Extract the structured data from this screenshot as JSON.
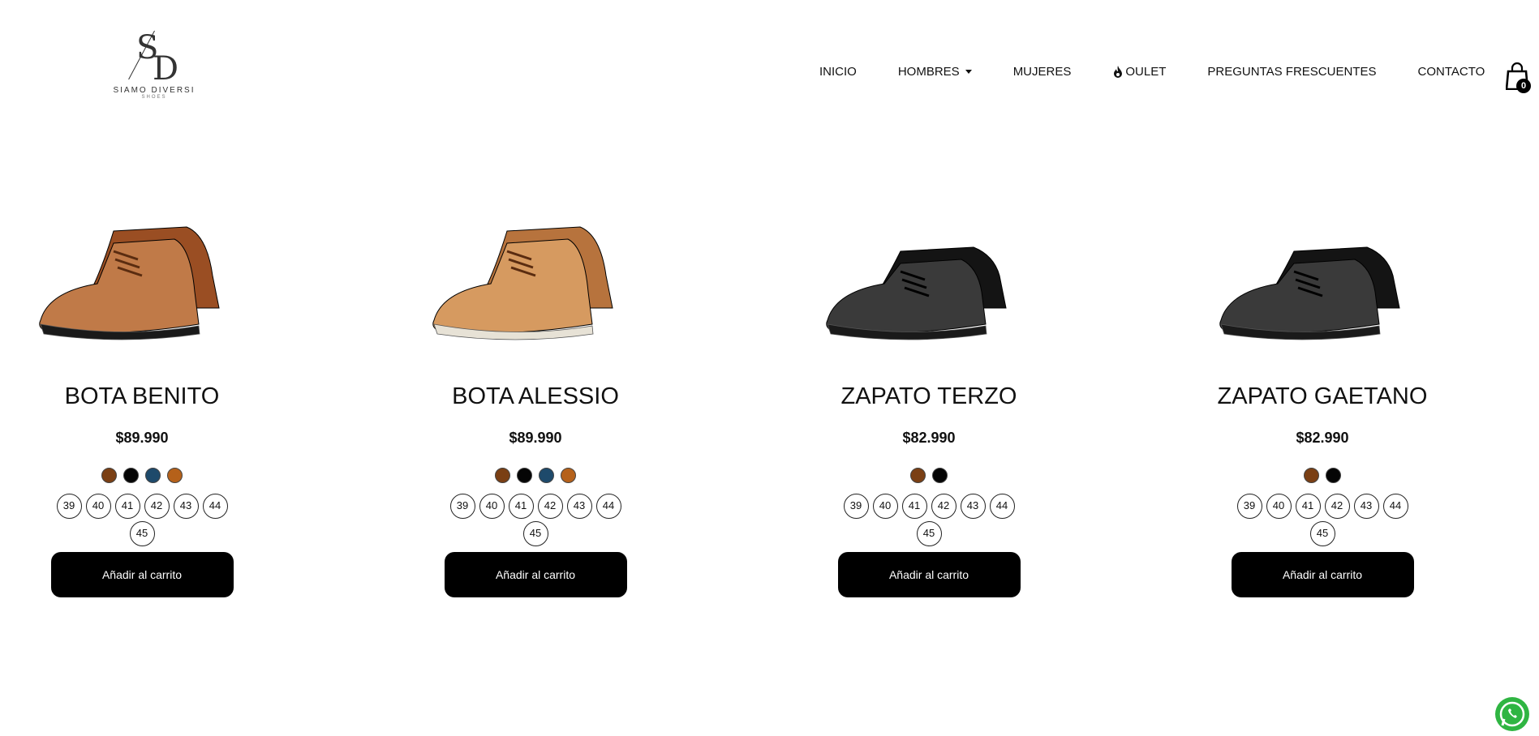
{
  "header": {
    "logo": {
      "brand": "SIAMO DIVERSI",
      "sub": "SHOES",
      "monogram_s": "S",
      "monogram_d": "D"
    },
    "nav": [
      {
        "label": "INICIO",
        "icon": null,
        "dropdown": false
      },
      {
        "label": "HOMBRES",
        "icon": null,
        "dropdown": true
      },
      {
        "label": "MUJERES",
        "icon": null,
        "dropdown": false
      },
      {
        "label": "OULET",
        "icon": "flame-icon",
        "dropdown": false
      },
      {
        "label": "PREGUNTAS FRESCUENTES",
        "icon": null,
        "dropdown": false
      },
      {
        "label": "CONTACTO",
        "icon": null,
        "dropdown": false
      }
    ],
    "cart_count": "0"
  },
  "products": [
    {
      "name": "BOTA BENITO",
      "price": "$89.990",
      "image": "brown-chukka-boot",
      "colors": [
        "#7a3f14",
        "#050505",
        "#1e4a6b",
        "#b5611a"
      ],
      "sizes": [
        "39",
        "40",
        "41",
        "42",
        "43",
        "44",
        "45"
      ],
      "button": "Añadir al carrito"
    },
    {
      "name": "BOTA ALESSIO",
      "price": "$89.990",
      "image": "tan-boot-white-sole",
      "colors": [
        "#7a3f14",
        "#050505",
        "#1e4a6b",
        "#b5611a"
      ],
      "sizes": [
        "39",
        "40",
        "41",
        "42",
        "43",
        "44",
        "45"
      ],
      "button": "Añadir al carrito"
    },
    {
      "name": "ZAPATO TERZO",
      "price": "$82.990",
      "image": "black-oxford-shoe",
      "colors": [
        "#7a3f14",
        "#050505"
      ],
      "sizes": [
        "39",
        "40",
        "41",
        "42",
        "43",
        "44",
        "45"
      ],
      "button": "Añadir al carrito"
    },
    {
      "name": "ZAPATO GAETANO",
      "price": "$82.990",
      "image": "black-captoe-shoe",
      "colors": [
        "#7a3f14",
        "#050505"
      ],
      "sizes": [
        "39",
        "40",
        "41",
        "42",
        "43",
        "44",
        "45"
      ],
      "button": "Añadir al carrito"
    }
  ],
  "colors": {
    "button_bg": "#000000",
    "whatsapp": "#2fb542"
  }
}
